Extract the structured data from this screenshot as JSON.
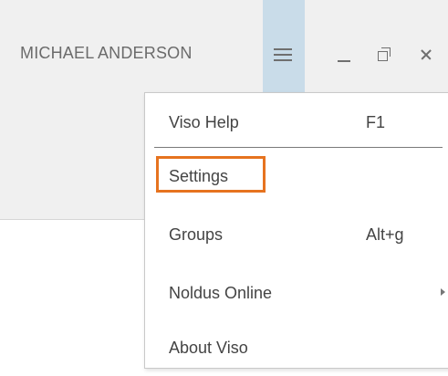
{
  "header": {
    "user_name": "MICHAEL ANDERSON"
  },
  "window_controls": {
    "menu_icon": "hamburger-icon",
    "minimize_icon": "minimize-icon",
    "restore_icon": "restore-icon",
    "close_icon": "close-icon"
  },
  "menu": {
    "items": [
      {
        "label": "Viso Help",
        "shortcut": "F1"
      },
      {
        "label": "Settings",
        "shortcut": ""
      },
      {
        "label": "Groups",
        "shortcut": "Alt+g"
      },
      {
        "label": "Noldus Online",
        "shortcut": "",
        "submenu_icon": "chevron-right-icon"
      },
      {
        "label": "About Viso",
        "shortcut": ""
      }
    ]
  },
  "colors": {
    "menu_toggle_bg": "#c9dce9",
    "highlight": "#e6731f"
  }
}
